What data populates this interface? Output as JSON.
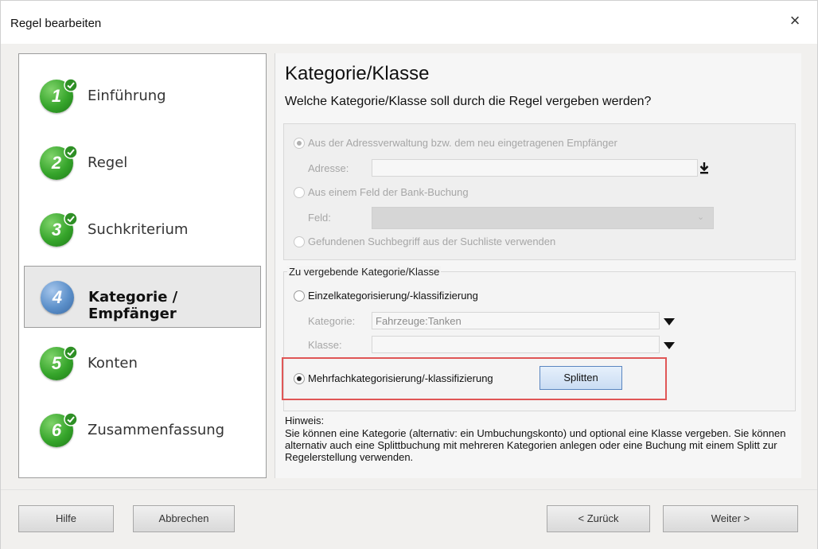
{
  "window": {
    "title": "Regel bearbeiten",
    "close_glyph": "×"
  },
  "steps": [
    {
      "number": "1",
      "label": "Einführung",
      "state": "done"
    },
    {
      "number": "2",
      "label": "Regel",
      "state": "done"
    },
    {
      "number": "3",
      "label": "Suchkriterium",
      "state": "done"
    },
    {
      "number": "4",
      "label": "Kategorie / Empfänger",
      "state": "active"
    },
    {
      "number": "5",
      "label": "Konten",
      "state": "pending"
    },
    {
      "number": "6",
      "label": "Zusammenfassung",
      "state": "pending"
    }
  ],
  "content": {
    "heading": "Kategorie/Klasse",
    "subheading": "Welche Kategorie/Klasse soll durch die Regel vergeben werden?",
    "source": {
      "option_address": "Aus der Adressverwaltung bzw. dem neu eingetragenen Empfänger",
      "address_label": "Adresse:",
      "address_value": "",
      "option_field": "Aus einem Feld der Bank-Buchung",
      "field_label": "Feld:",
      "field_value": "",
      "option_search": "Gefundenen Suchbegriff aus der Suchliste verwenden"
    },
    "assign": {
      "group_title": "Zu vergebende Kategorie/Klasse",
      "option_single": "Einzelkategorisierung/-klassifizierung",
      "category_label": "Kategorie:",
      "category_value": "Fahrzeuge:Tanken",
      "class_label": "Klasse:",
      "class_value": "",
      "option_multi": "Mehrfachkategorisierung/-klassifizierung",
      "split_button": "Splitten"
    },
    "hint_title": "Hinweis:",
    "hint_text": "Sie können eine Kategorie (alternativ: ein Umbuchungskonto) und optional eine Klasse vergeben. Sie können alternativ auch eine Splittbuchung mit mehreren Kategorien anlegen oder eine Buchung mit einem Splitt zur Regelerstellung verwenden."
  },
  "footer": {
    "help": "Hilfe",
    "cancel": "Abbrechen",
    "back": "< Zurück",
    "next": "Weiter >"
  },
  "colors": {
    "accent_red": "#e05656",
    "step_done": "#36a52b",
    "step_active": "#5b8fc9",
    "split_border": "#5a86c0"
  },
  "icons": {
    "step_done": "check-icon",
    "address_picker": "arrow-down-to-line-icon",
    "dropdown": "triangle-down-icon"
  }
}
